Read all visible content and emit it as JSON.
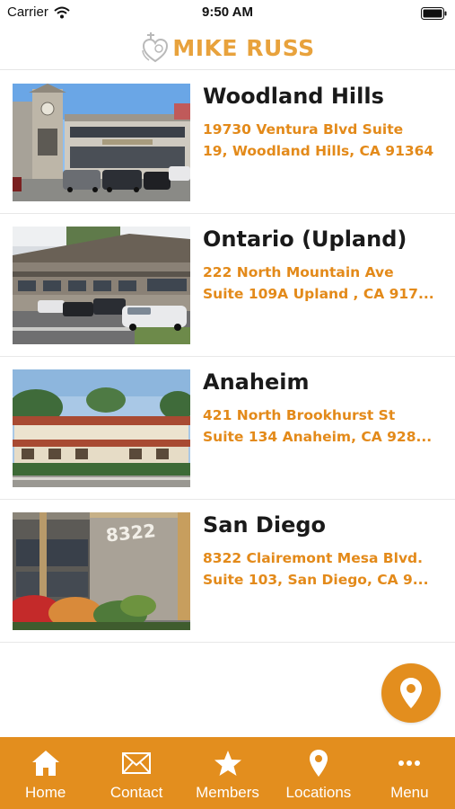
{
  "status_bar": {
    "carrier": "Carrier",
    "time": "9:50 AM"
  },
  "header": {
    "logo_text": "MIKE RUSS"
  },
  "locations": [
    {
      "name": "Woodland Hills",
      "address_line1": "19730 Ventura Blvd  Suite",
      "address_line2": "19, Woodland Hills, CA 91364",
      "photo": "office-building-with-clock-tower-photo"
    },
    {
      "name": "Ontario (Upland)",
      "address_line1": "222 North Mountain Ave",
      "address_line2": "Suite 109A Upland , CA 917...",
      "photo": "two-story-office-building-parking-lot-photo"
    },
    {
      "name": "Anaheim",
      "address_line1": "421 North Brookhurst St",
      "address_line2": "Suite 134 Anaheim, CA 928...",
      "photo": "red-tile-roof-building-photo"
    },
    {
      "name": "San Diego",
      "address_line1": "8322 Clairemont Mesa Blvd.",
      "address_line2": "Suite 103, San Diego, CA 9...",
      "photo": "building-8322-sign-photo"
    }
  ],
  "photo_text": {
    "san_diego_sign": "8322"
  },
  "fab": {
    "icon": "map-pin-icon"
  },
  "tabs": [
    {
      "label": "Home",
      "icon": "home-icon"
    },
    {
      "label": "Contact",
      "icon": "envelope-icon"
    },
    {
      "label": "Members",
      "icon": "star-icon"
    },
    {
      "label": "Locations",
      "icon": "map-pin-icon"
    },
    {
      "label": "Menu",
      "icon": "more-dots-icon"
    }
  ],
  "colors": {
    "accent": "#e38e1e",
    "logo": "#e8a23c",
    "address": "#e38a1a",
    "tab_label": "#ffffff"
  }
}
